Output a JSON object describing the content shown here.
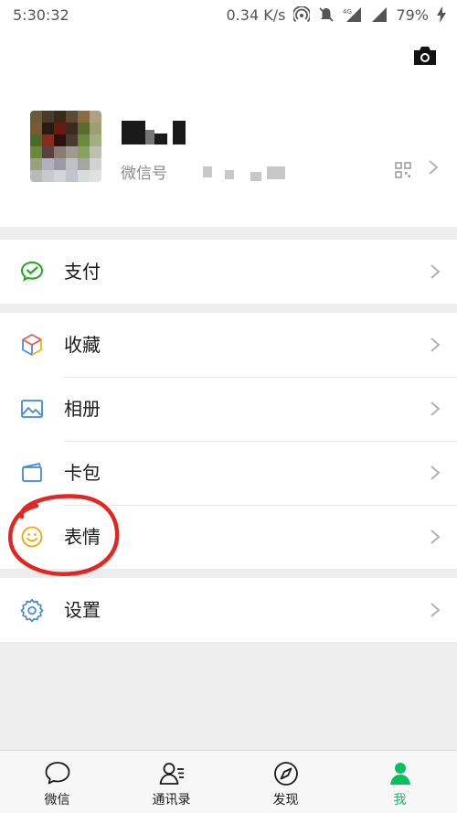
{
  "status_bar": {
    "time": "5:30:32",
    "network_speed": "0.34 K/s",
    "network_type": "4G",
    "battery": "79%"
  },
  "profile": {
    "wechat_id_label": "微信号"
  },
  "menu": {
    "pay": {
      "label": "支付",
      "icon": "wechat-pay-icon"
    },
    "favorites": {
      "label": "收藏",
      "icon": "cube-icon"
    },
    "album": {
      "label": "相册",
      "icon": "image-icon"
    },
    "cards": {
      "label": "卡包",
      "icon": "wallet-icon"
    },
    "stickers": {
      "label": "表情",
      "icon": "smiley-icon"
    },
    "settings": {
      "label": "设置",
      "icon": "gear-icon"
    }
  },
  "bottom_nav": [
    {
      "label": "微信",
      "icon": "chat-bubble-icon"
    },
    {
      "label": "通讯录",
      "icon": "contacts-icon"
    },
    {
      "label": "发现",
      "icon": "compass-icon"
    },
    {
      "label": "我",
      "icon": "me-icon",
      "active": true
    }
  ],
  "colors": {
    "accent": "#07c160",
    "annotation": "#e52620",
    "background": "#ededed"
  }
}
